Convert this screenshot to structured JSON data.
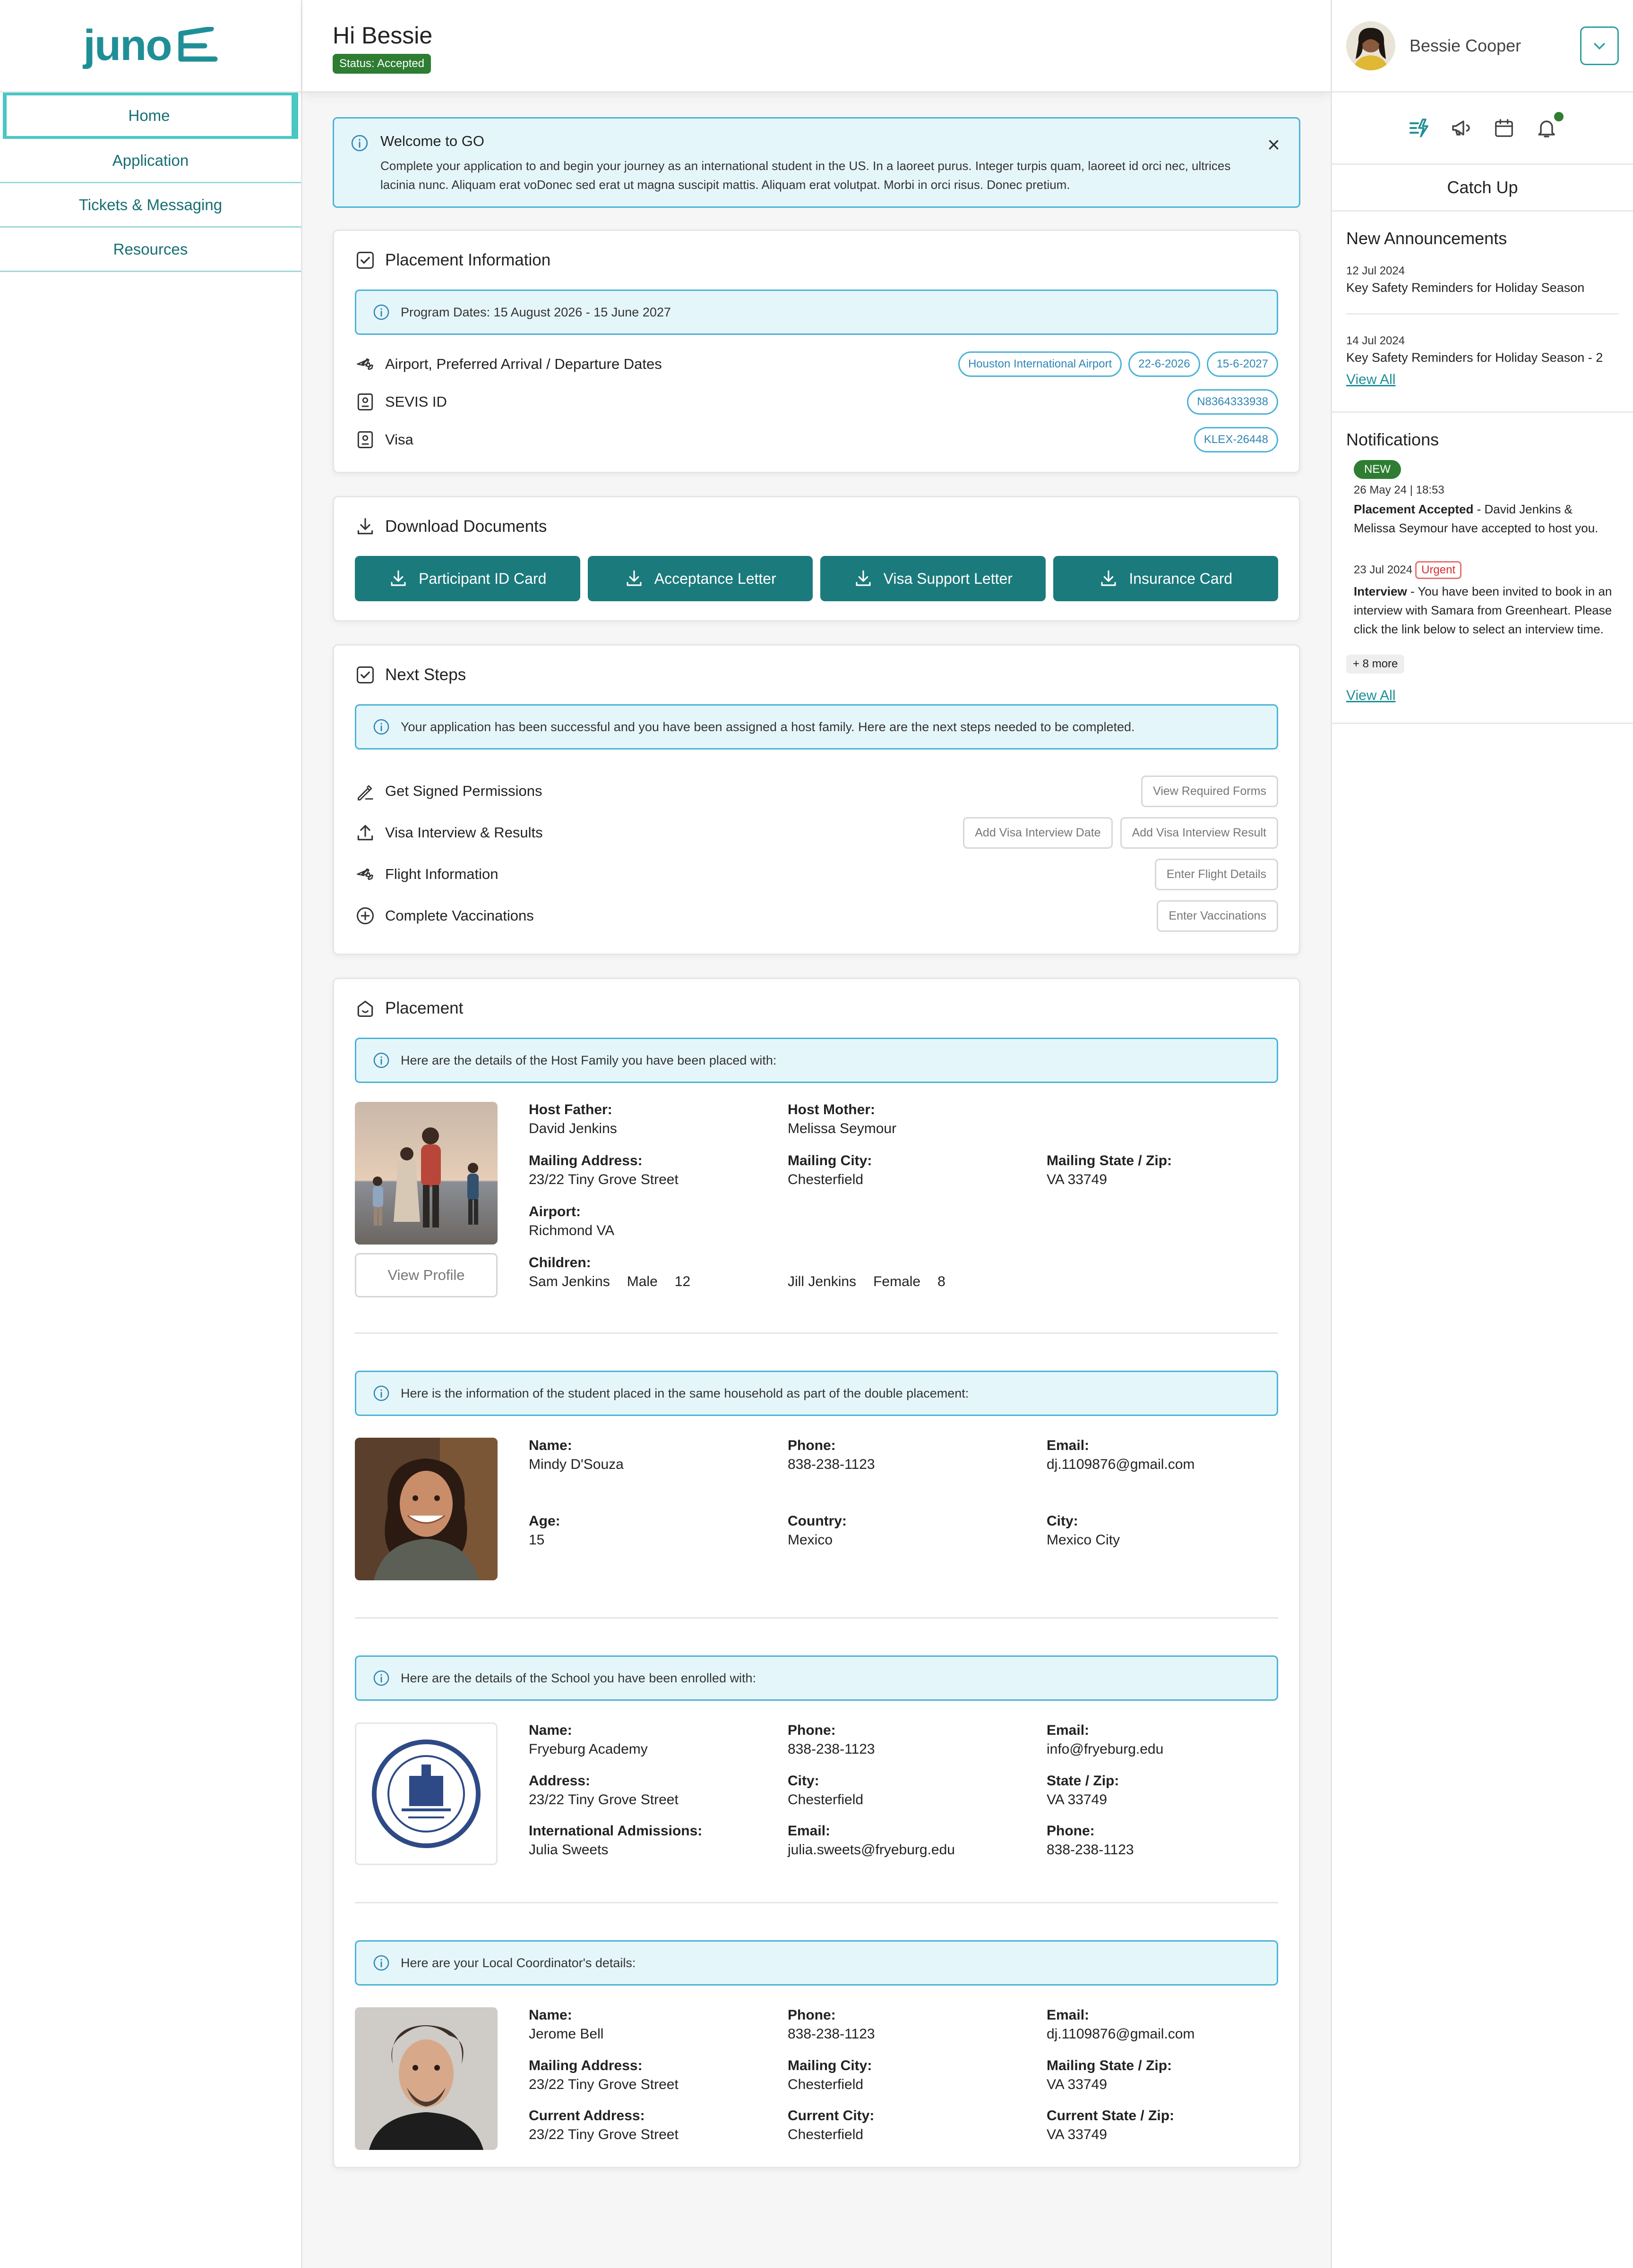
{
  "brand": {
    "name": "juno"
  },
  "nav": {
    "items": [
      {
        "label": "Home",
        "active": true
      },
      {
        "label": "Application"
      },
      {
        "label": "Tickets & Messaging"
      },
      {
        "label": "Resources"
      }
    ]
  },
  "header": {
    "greeting": "Hi Bessie",
    "status": "Status: Accepted"
  },
  "user": {
    "name": "Bessie Cooper"
  },
  "welcome": {
    "title": "Welcome to GO",
    "text": "Complete your application to and begin your journey as an international student in the US. In a laoreet purus. Integer turpis quam, laoreet id orci nec, ultrices lacinia nunc. Aliquam erat voDonec sed erat ut magna suscipit mattis. Aliquam erat volutpat. Morbi in orci risus. Donec pretium."
  },
  "placement_info": {
    "title": "Placement Information",
    "program_dates": "Program Dates: 15 August 2026 - 15 June 2027",
    "airport_label": "Airport, Preferred Arrival / Departure Dates",
    "airport": "Houston International Airport",
    "arrival": "22-6-2026",
    "departure": "15-6-2027",
    "sevis_label": "SEVIS ID",
    "sevis": "N8364333938",
    "visa_label": "Visa",
    "visa": "KLEX-26448"
  },
  "downloads": {
    "title": "Download Documents",
    "buttons": [
      "Participant ID Card",
      "Acceptance Letter",
      "Visa Support Letter",
      "Insurance Card"
    ]
  },
  "next_steps": {
    "title": "Next Steps",
    "info": "Your application has been successful and you have been assigned a host family. Here are the next steps needed to be completed.",
    "steps": [
      {
        "label": "Get Signed Permissions",
        "actions": [
          "View Required Forms"
        ]
      },
      {
        "label": "Visa Interview & Results",
        "actions": [
          "Add Visa Interview Date",
          "Add Visa Interview Result"
        ]
      },
      {
        "label": "Flight Information",
        "actions": [
          "Enter Flight Details"
        ]
      },
      {
        "label": "Complete Vaccinations",
        "actions": [
          "Enter Vaccinations"
        ]
      }
    ]
  },
  "placement": {
    "title": "Placement",
    "host_info": "Here are the details of the Host Family you have been placed with:",
    "host": {
      "father_label": "Host Father:",
      "father": "David Jenkins",
      "mother_label": "Host Mother:",
      "mother": "Melissa Seymour",
      "address_label": "Mailing Address:",
      "address": "23/22 Tiny Grove Street",
      "city_label": "Mailing City:",
      "city": "Chesterfield",
      "state_label": "Mailing State / Zip:",
      "state": "VA 33749",
      "airport_label": "Airport:",
      "airport": "Richmond VA",
      "children_label": "Children:",
      "children": [
        {
          "name": "Sam Jenkins",
          "gender": "Male",
          "age": "12"
        },
        {
          "name": "Jill Jenkins",
          "gender": "Female",
          "age": "8"
        }
      ],
      "view_profile": "View Profile"
    },
    "student_info": "Here is the information of the student placed in the same household as part of the double placement:",
    "student": {
      "name_label": "Name:",
      "name": "Mindy D'Souza",
      "phone_label": "Phone:",
      "phone": "838-238-1123",
      "email_label": "Email:",
      "email": "dj.1109876@gmail.com",
      "age_label": "Age:",
      "age": "15",
      "country_label": "Country:",
      "country": "Mexico",
      "city_label": "City:",
      "city": "Mexico City"
    },
    "school_info": "Here are the details of the School you have been enrolled with:",
    "school": {
      "name_label": "Name:",
      "name": "Fryeburg Academy",
      "phone_label": "Phone:",
      "phone": "838-238-1123",
      "email_label": "Email:",
      "email": "info@fryeburg.edu",
      "address_label": "Address:",
      "address": "23/22 Tiny Grove Street",
      "city_label": "City:",
      "city": "Chesterfield",
      "state_label": "State / Zip:",
      "state": "VA 33749",
      "intl_label": "International Admissions:",
      "intl": "Julia Sweets",
      "intl_email_label": "Email:",
      "intl_email": "julia.sweets@fryeburg.edu",
      "intl_phone_label": "Phone:",
      "intl_phone": "838-238-1123"
    },
    "coord_info": "Here are your Local Coordinator's details:",
    "coord": {
      "name_label": "Name:",
      "name": "Jerome Bell",
      "phone_label": "Phone:",
      "phone": "838-238-1123",
      "email_label": "Email:",
      "email": "dj.1109876@gmail.com",
      "maddr_label": "Mailing Address:",
      "maddr": "23/22 Tiny Grove Street",
      "mcity_label": "Mailing City:",
      "mcity": "Chesterfield",
      "mstate_label": "Mailing State / Zip:",
      "mstate": "VA 33749",
      "caddr_label": "Current Address:",
      "caddr": "23/22 Tiny Grove Street",
      "ccity_label": "Current City:",
      "ccity": "Chesterfield",
      "cstate_label": "Current State / Zip:",
      "cstate": "VA 33749"
    }
  },
  "catch_up": {
    "title": "Catch Up",
    "announcements_title": "New Announcements",
    "announcements": [
      {
        "date": "12 Jul 2024",
        "text": "Key Safety Reminders for Holiday Season"
      },
      {
        "date": "14 Jul 2024",
        "text": "Key Safety Reminders for Holiday Season - 2"
      }
    ],
    "view_all": "View All",
    "notifications_title": "Notifications",
    "notifications": [
      {
        "badge": "NEW",
        "date": "26 May 24 | 18:53",
        "bold": "Placement Accepted",
        "text": " - David Jenkins & Melissa Seymour have accepted to host you."
      },
      {
        "badge": "Urgent",
        "date": "23 Jul 2024",
        "bold": "Interview",
        "text": " - You have been invited to book in an interview with Samara from Greenheart. Please click the link below to select an interview time."
      }
    ],
    "more": "+ 8 more"
  }
}
